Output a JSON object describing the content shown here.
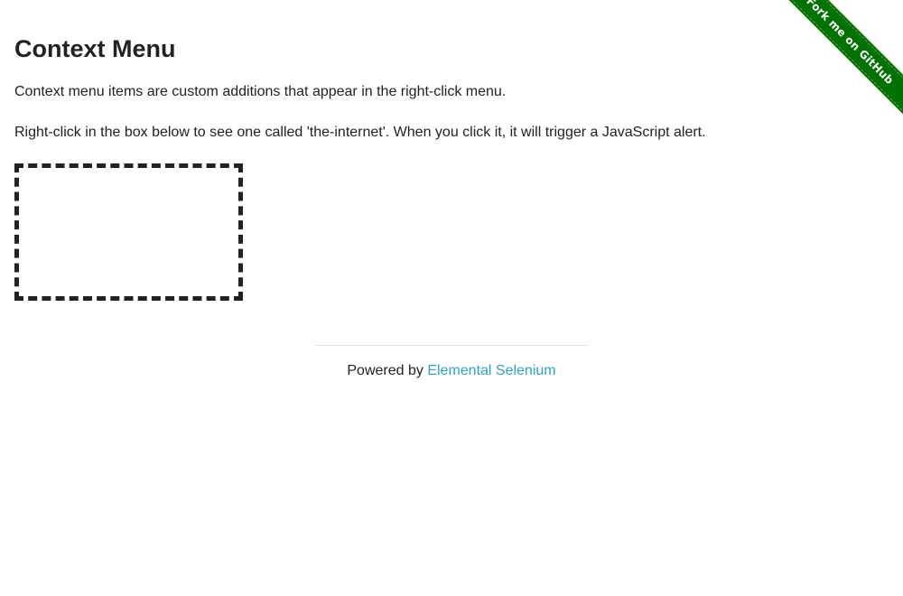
{
  "page": {
    "title": "Context Menu",
    "paragraph_1": "Context menu items are custom additions that appear in the right-click menu.",
    "paragraph_2": "Right-click in the box below to see one called 'the-internet'. When you click it, it will trigger a JavaScript alert."
  },
  "footer": {
    "prefix": "Powered by ",
    "link_text": "Elemental Selenium"
  },
  "ribbon": {
    "text": "Fork me on GitHub",
    "color": "#007200"
  },
  "colors": {
    "text": "#222222",
    "link": "#2ba6cb",
    "box_border": "#222222"
  }
}
